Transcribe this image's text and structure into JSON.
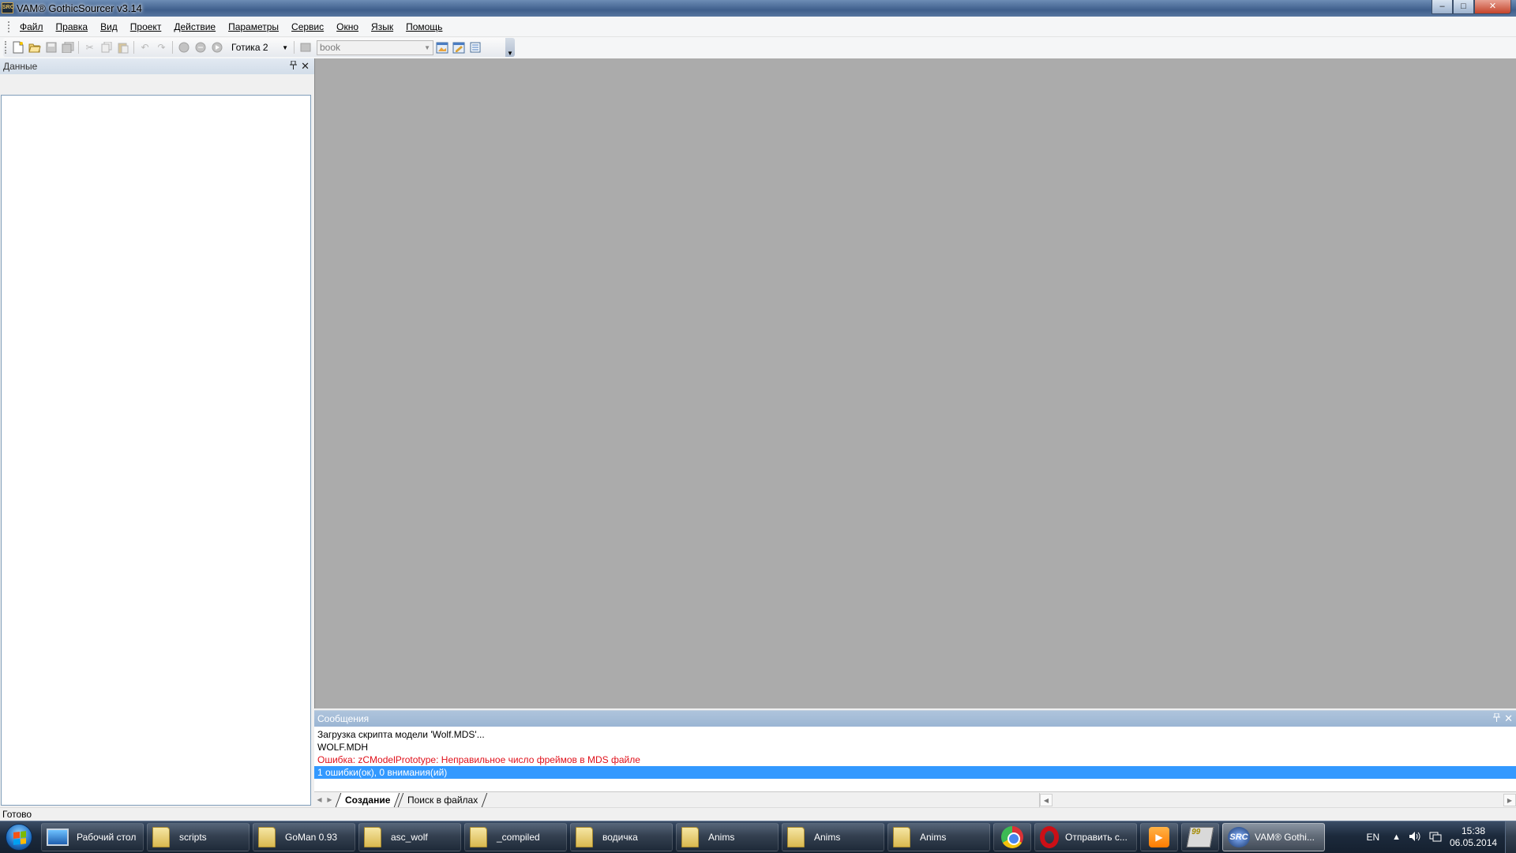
{
  "window": {
    "title": "VAM® GothicSourcer v3.14",
    "app_icon_text": "SRC",
    "minimize_label": "–",
    "maximize_label": "□",
    "close_label": "✕"
  },
  "menu": [
    "Файл",
    "Правка",
    "Вид",
    "Проект",
    "Действие",
    "Параметры",
    "Сервис",
    "Окно",
    "Язык",
    "Помощь"
  ],
  "toolbar": {
    "game_select": "Готика 2",
    "book_combo": "book",
    "dropdown_arrow": "▼"
  },
  "data_panel": {
    "title": "Данные",
    "pin": "📌",
    "close": "✕"
  },
  "messages": {
    "title": "Сообщения",
    "pin": "📌",
    "close": "✕",
    "lines": [
      {
        "text": "Загрузка скрипта модели 'Wolf.MDS'...",
        "type": "info"
      },
      {
        "text": "WOLF.MDH",
        "type": "info"
      },
      {
        "text": "Ошибка: zCModelPrototype: Неправильное число фреймов в MDS файле",
        "type": "error"
      },
      {
        "text": "1 ошибки(ок), 0 внимания(ий)",
        "type": "selected"
      }
    ],
    "tabs": [
      "Создание",
      "Поиск в файлах"
    ],
    "nav_left": "◀",
    "nav_right": "▶"
  },
  "status_bar": {
    "text": "Готово"
  },
  "taskbar": {
    "items": [
      {
        "label": "Рабочий стол",
        "icon": "desktop-icon"
      },
      {
        "label": "scripts",
        "icon": "folder-icon"
      },
      {
        "label": "GoMan 0.93",
        "icon": "folder-icon"
      },
      {
        "label": "asc_wolf",
        "icon": "folder-icon"
      },
      {
        "label": "_compiled",
        "icon": "folder-icon"
      },
      {
        "label": "водичка",
        "icon": "folder-icon"
      },
      {
        "label": "Anims",
        "icon": "folder-icon"
      },
      {
        "label": "Anims",
        "icon": "folder-icon"
      },
      {
        "label": "Anims",
        "icon": "folder-icon"
      }
    ],
    "opera_label": "Отправить с...",
    "gothic_label": "VAM® Gothi...",
    "notes_badge": "99",
    "src_icon_text": "SRC",
    "language": "EN",
    "time": "15:38",
    "date": "06.05.2014"
  },
  "colors": {
    "workspace_bg": "#ababab",
    "selection": "#3399ff",
    "error_text": "#e0101a",
    "messages_header": "#9bb5d3"
  }
}
